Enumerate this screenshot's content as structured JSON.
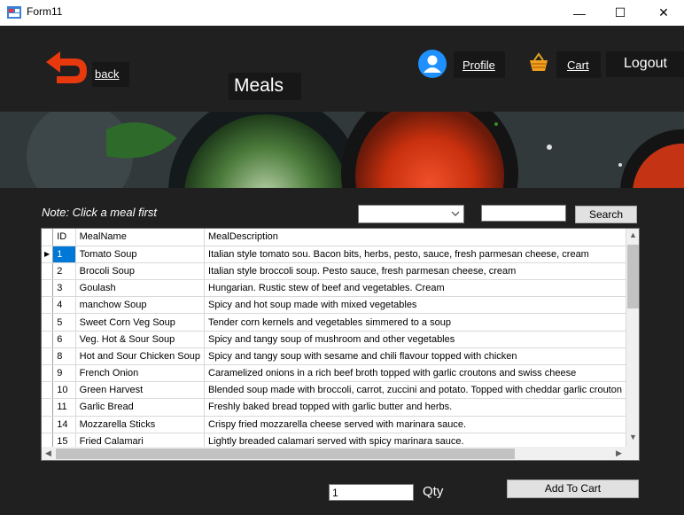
{
  "window": {
    "title": "Form11",
    "minimize": "—",
    "maximize": "☐",
    "close": "✕"
  },
  "header": {
    "back_label": "back",
    "page_title": "Meals",
    "profile_label": "Profile",
    "cart_label": "Cart",
    "logout_label": "Logout",
    "icons": {
      "back": "back-arrow-icon",
      "profile": "user-icon",
      "cart": "basket-icon"
    }
  },
  "banner": {
    "image": "soup-bowls-banner"
  },
  "filters": {
    "note": "Note: Click a meal first",
    "combo_value": "",
    "search_value": "",
    "search_button": "Search"
  },
  "grid": {
    "columns": [
      "ID",
      "MealName",
      "MealDescription"
    ],
    "rows": [
      {
        "id": "1",
        "name": "Tomato Soup",
        "desc": "Italian style tomato sou. Bacon bits, herbs, pesto, sauce, fresh parmesan cheese, cream"
      },
      {
        "id": "2",
        "name": "Brocoli Soup",
        "desc": "Italian style broccoli soup. Pesto sauce, fresh parmesan cheese, cream"
      },
      {
        "id": "3",
        "name": "Goulash",
        "desc": "Hungarian. Rustic stew of beef and vegetables. Cream"
      },
      {
        "id": "4",
        "name": "manchow Soup",
        "desc": "Spicy and hot soup made with mixed vegetables"
      },
      {
        "id": "5",
        "name": "Sweet Corn Veg Soup",
        "desc": "Tender  corn kernels and vegetables simmered to a soup"
      },
      {
        "id": "6",
        "name": "Veg. Hot & Sour Soup",
        "desc": "Spicy and tangy soup of mushroom and other vegetables"
      },
      {
        "id": "8",
        "name": "Hot and Sour Chicken Soup",
        "desc": "Spicy and tangy soup with sesame and chili flavour topped with chicken"
      },
      {
        "id": "9",
        "name": "French Onion",
        "desc": "Caramelized onions in a rich beef broth topped with garlic croutons and swiss cheese"
      },
      {
        "id": "10",
        "name": "Green Harvest",
        "desc": "Blended soup made with broccoli, carrot, zuccini and potato. Topped with cheddar garlic crouton"
      },
      {
        "id": "11",
        "name": "Garlic Bread",
        "desc": "Freshly baked bread topped with garlic butter and herbs."
      },
      {
        "id": "14",
        "name": "Mozzarella Sticks",
        "desc": "Crispy fried mozzarella cheese served with marinara sauce."
      },
      {
        "id": "15",
        "name": "Fried Calamari",
        "desc": "Lightly breaded calamari served with spicy marinara sauce."
      }
    ],
    "selected_row_marker": "▶"
  },
  "bottom": {
    "qty_value": "1",
    "qty_label": "Qty",
    "add_to_cart": "Add To Cart"
  },
  "colors": {
    "background": "#202020",
    "accent_red": "#e8390e",
    "selection": "#0078d7",
    "profile_blue": "#1e90ff",
    "cart_orange": "#f0a020"
  }
}
